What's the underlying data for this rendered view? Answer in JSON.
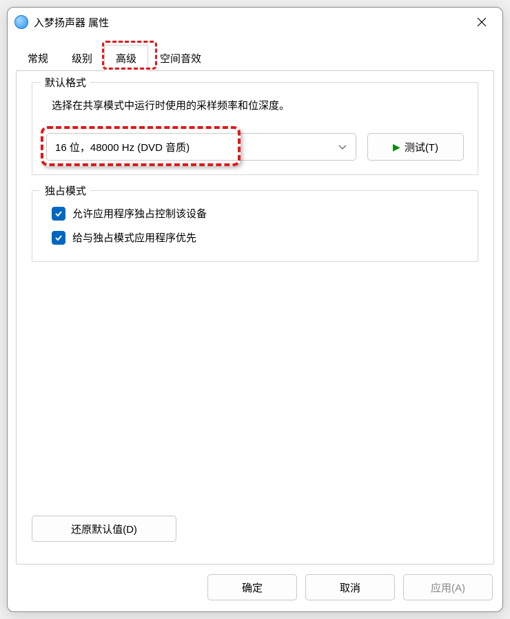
{
  "titlebar": {
    "icon_label": "入梦",
    "title": "入梦扬声器 属性"
  },
  "tabs": {
    "general": "常规",
    "levels": "级别",
    "advanced": "高级",
    "spatial": "空间音效"
  },
  "default_format": {
    "legend": "默认格式",
    "description": "选择在共享模式中运行时使用的采样频率和位深度。",
    "selected_value": "16 位，48000 Hz (DVD 音质)",
    "test_button": "测试(T)"
  },
  "exclusive_mode": {
    "legend": "独占模式",
    "checkbox1": "允许应用程序独占控制该设备",
    "checkbox2": "给与独占模式应用程序优先"
  },
  "restore_defaults": "还原默认值(D)",
  "buttons": {
    "ok": "确定",
    "cancel": "取消",
    "apply": "应用(A)"
  }
}
